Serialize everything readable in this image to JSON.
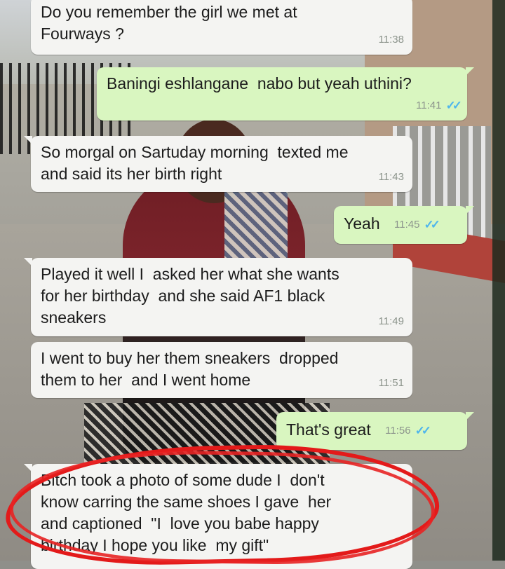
{
  "messages": [
    {
      "id": "m1",
      "dir": "in",
      "text": "Do you remember the girl we met at\nFourways ?",
      "time": "11:38"
    },
    {
      "id": "m2",
      "dir": "out",
      "text": "Baningi eshlangane  nabo but yeah uthini?",
      "time": "11:41"
    },
    {
      "id": "m3",
      "dir": "in",
      "text": "So morgal on Sartuday morning  texted me\nand said its her birth right",
      "time": "11:43"
    },
    {
      "id": "m4",
      "dir": "out",
      "text": "Yeah",
      "time": "11:45"
    },
    {
      "id": "m5",
      "dir": "in",
      "text": "Played it well I  asked her what she wants\nfor her birthday  and she said AF1 black\nsneakers",
      "time": "11:49"
    },
    {
      "id": "m6",
      "dir": "in",
      "text": "I went to buy her them sneakers  dropped\nthem to her  and I went home",
      "time": "11:51"
    },
    {
      "id": "m7",
      "dir": "out",
      "text": "That's great",
      "time": "11:56"
    },
    {
      "id": "m8",
      "dir": "in",
      "text": "Bitch took a photo of some dude I  don't\nknow carring the same shoes I gave  her\nand captioned  \"I  love you babe happy\nbirthday I hope you like  my gift\"",
      "time": ""
    }
  ],
  "read_ticks": "✓✓",
  "colors": {
    "incoming": "#f4f4f2",
    "outgoing": "#d9f6c0",
    "ticks": "#4fb6ec",
    "highlight": "#e31a1a"
  }
}
